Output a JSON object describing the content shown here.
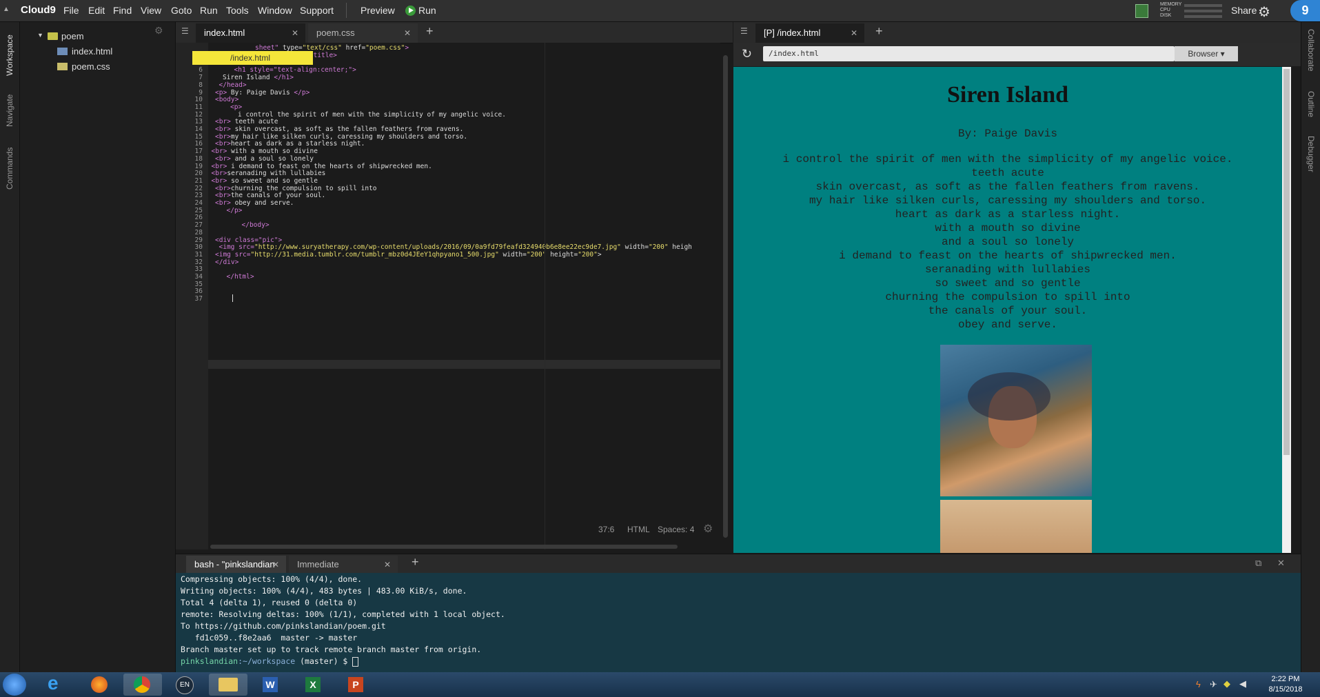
{
  "menubar": {
    "logo": "Cloud9",
    "items": [
      "File",
      "Edit",
      "Find",
      "View",
      "Goto",
      "Run",
      "Tools",
      "Window",
      "Support"
    ],
    "preview": "Preview",
    "run": "Run",
    "meters": [
      "MEMORY",
      "CPU",
      "DISK"
    ],
    "share": "Share",
    "badge": "9"
  },
  "left_rail": {
    "items": [
      "Workspace",
      "Navigate",
      "Commands"
    ]
  },
  "right_rail": {
    "items": [
      "Collaborate",
      "Outline",
      "Debugger"
    ]
  },
  "tree": {
    "folder": "poem",
    "files": [
      "index.html",
      "poem.css"
    ]
  },
  "editor": {
    "tabs": [
      "index.html",
      "poem.css"
    ],
    "tooltip": "/index.html",
    "line_numbers": [
      "4",
      "5",
      "6",
      "7",
      "8",
      "9",
      "10",
      "11",
      "12",
      "13",
      "14",
      "15",
      "16",
      "17",
      "18",
      "19",
      "20",
      "21",
      "22",
      "23",
      "24",
      "25",
      "26",
      "27",
      "28",
      "29",
      "30",
      "31",
      "32",
      "33",
      "34",
      "35",
      "36",
      "37"
    ],
    "lines": [
      [
        "",
        "<title>",
        " Siren Island ",
        "</title>"
      ],
      [
        "",
        "<head>"
      ],
      [
        "",
        "<h1 style=\"text-align:center;\">"
      ],
      [
        "",
        "Siren Island ",
        "</h1>"
      ],
      [
        "",
        "</head>"
      ],
      [
        "",
        "<p>",
        " By: Paige Davis ",
        "</p>"
      ],
      [
        "",
        "<body>"
      ],
      [
        "",
        "<p>"
      ],
      [
        "",
        "i control the spirit of men with the simplicity of my angelic voice."
      ],
      [
        "",
        "<br>",
        " teeth acute"
      ],
      [
        "",
        "<br>",
        " skin overcast, as soft as the fallen feathers from ravens."
      ],
      [
        "",
        "<br>",
        "my hair like silken curls, caressing my shoulders and torso."
      ],
      [
        "",
        "<br>",
        "heart as dark as a starless night."
      ],
      [
        "",
        "<br>",
        " with a mouth so divine"
      ],
      [
        "",
        "<br>",
        " and a soul so lonely"
      ],
      [
        "",
        "<br>",
        " i demand to feast on the hearts of shipwrecked men."
      ],
      [
        "",
        "<br>",
        "seranading with lullabies"
      ],
      [
        "",
        "<br>",
        " so sweet and so gentle"
      ],
      [
        "",
        "<br>",
        "churning the compulsion to spill into"
      ],
      [
        "",
        "<br>",
        "the canals of your soul."
      ],
      [
        "",
        "<br>",
        " obey and serve."
      ],
      [
        "",
        "</p>"
      ],
      [
        ""
      ],
      [
        "",
        "</body>"
      ],
      [
        ""
      ],
      [
        "",
        "<div class=\"pic\">"
      ],
      [
        "",
        "<img src=",
        "\"http://www.suryatherapy.com/wp-content/uploads/2016/09/0a9fd79feafd324940b6e8ee22ec9de7.jpg\"",
        " width=",
        "\"200\"",
        " heigh"
      ],
      [
        "",
        "<img src=",
        "\"http://31.media.tumblr.com/tumblr_mbz0d4JEeY1qhpyano1_500.jpg\"",
        " width=",
        "\"200\"",
        " height=",
        "\"200\"",
        ">"
      ],
      [
        "",
        "</div>"
      ],
      [
        ""
      ],
      [
        "",
        "</html>"
      ],
      [
        ""
      ],
      [
        ""
      ],
      [
        ""
      ]
    ],
    "line1_fragment": [
      "sheet\" ",
      "type=",
      "\"text/css\"",
      " href=",
      "\"poem.css\"",
      ">"
    ],
    "status": {
      "position": "37:6",
      "mode": "HTML",
      "spaces": "Spaces: 4"
    }
  },
  "preview": {
    "tab": "[P] /index.html",
    "url": "/index.html",
    "browser": "Browser",
    "title": "Siren Island",
    "byline": "By: Paige Davis",
    "poem": [
      "i control the spirit of men with the simplicity of my angelic voice.",
      "teeth acute",
      "skin overcast, as soft as the fallen feathers from ravens.",
      "my hair like silken curls, caressing my shoulders and torso.",
      "heart as dark as a starless night.",
      "with a mouth so divine",
      "and a soul so lonely",
      "i demand to feast on the hearts of shipwrecked men.",
      "seranading with lullabies",
      "so sweet and so gentle",
      "churning the compulsion to spill into",
      "the canals of your soul.",
      "obey and serve."
    ]
  },
  "terminal": {
    "tabs": [
      "bash - \"pinkslandian·",
      "Immediate"
    ],
    "lines": [
      "Compressing objects: 100% (4/4), done.",
      "Writing objects: 100% (4/4), 483 bytes | 483.00 KiB/s, done.",
      "Total 4 (delta 1), reused 0 (delta 0)",
      "remote: Resolving deltas: 100% (1/1), completed with 1 local object.",
      "To https://github.com/pinkslandian/poem.git",
      "   fd1c059..f8e2aa6  master -> master",
      "Branch master set up to track remote branch master from origin."
    ],
    "prompt_user": "pinkslandian",
    "prompt_path": ":~/workspace",
    "prompt_branch": " (master) $ "
  },
  "taskbar": {
    "lang": "EN",
    "time": "2:22 PM",
    "date": "8/15/2018"
  }
}
